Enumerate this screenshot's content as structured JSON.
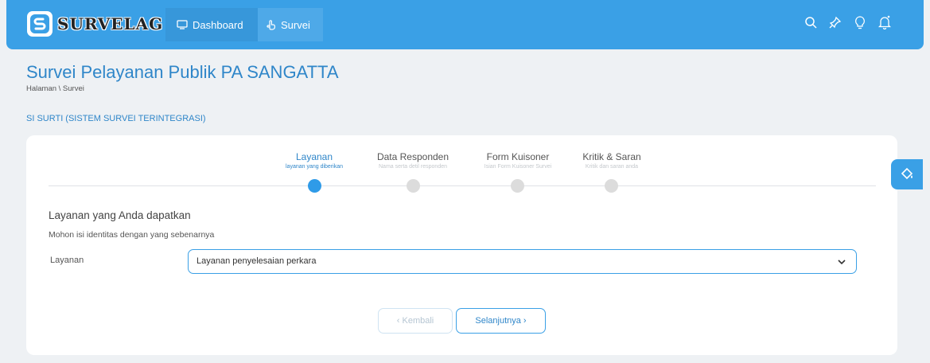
{
  "header": {
    "logo_text": "SURVELAG",
    "nav": [
      {
        "label": "Dashboard",
        "icon": "monitor-icon"
      },
      {
        "label": "Survei",
        "icon": "hand-pointer-icon"
      }
    ],
    "icons": [
      "search-icon",
      "pin-icon",
      "lightbulb-icon",
      "bell-icon"
    ]
  },
  "page": {
    "title": "Survei Pelayanan Publik PA SANGATTA",
    "breadcrumb": "Halaman \\ Survei",
    "section_label": "SI SURTI (SISTEM SURVEI TERINTEGRASI)"
  },
  "stepper": {
    "steps": [
      {
        "title": "Layanan",
        "subtitle": "layanan yang diberikan",
        "active": true
      },
      {
        "title": "Data Responden",
        "subtitle": "Nama serta detil responden",
        "active": false
      },
      {
        "title": "Form Kuisoner",
        "subtitle": "Isian Form Kuisoner Survei",
        "active": false
      },
      {
        "title": "Kritik & Saran",
        "subtitle": "Kritik dan saran anda",
        "active": false
      }
    ]
  },
  "form": {
    "title": "Layanan yang Anda dapatkan",
    "subtitle": "Mohon isi identitas dengan yang sebenarnya",
    "layanan_label": "Layanan",
    "layanan_value": "Layanan penyelesaian perkara"
  },
  "buttons": {
    "back_label": "‹ Kembali",
    "next_label": "Selanjutnya ›"
  },
  "colors": {
    "primary": "#3aa0e6",
    "text_blue": "#2f86c9",
    "background": "#eef1f4"
  }
}
